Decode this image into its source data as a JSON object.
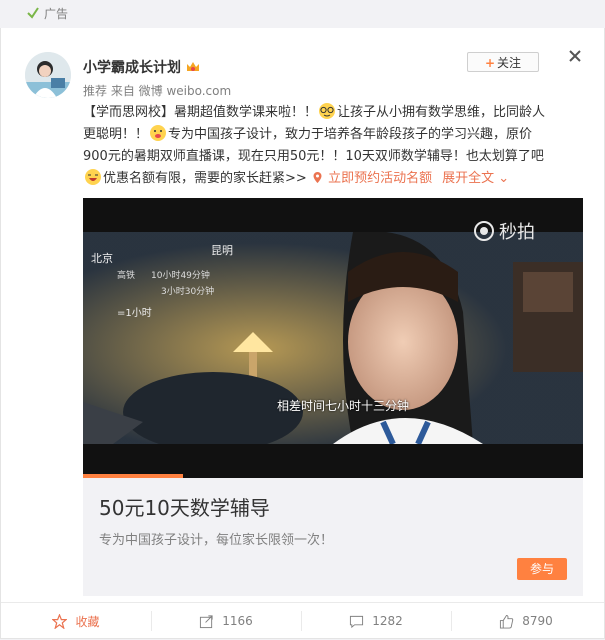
{
  "topbar": {
    "ad_label": "广告",
    "icon": "check-icon"
  },
  "post": {
    "username": "小学霸成长计划",
    "badge_icon": "crown-icon",
    "meta": "推荐 来自 微博 weibo.com",
    "follow_label": "关注",
    "close_icon": "close-icon",
    "lines": [
      {
        "a": "【学而思网校】暑期超值数学课来啦！！",
        "b": "让孩子从小拥有数学思维，比同龄人"
      },
      {
        "a": "更聪明！！",
        "b": "专为中国孩子设计，致力于培养各年龄段孩子的学习兴趣，原价"
      },
      {
        "a": "900元的暑期双师直播课，现在只用50元！！10天双师数学辅导！也太划算了吧"
      },
      {
        "a": "优惠名额有限，需要的家长赶紧>>",
        "link": "立即预约活动名额",
        "more": "展开全文"
      }
    ]
  },
  "video": {
    "brand": "秒拍",
    "subtitle": "相差时间七小时十三分钟",
    "progress": 0.2,
    "chalk": [
      "北京",
      "昆明",
      "高铁",
      "=1小时",
      "10小时49分钟",
      "3小时30分钟"
    ]
  },
  "promo": {
    "title": "50元10天数学辅导",
    "desc": "专为中国孩子设计，每位家长限领一次！",
    "join_label": "参与"
  },
  "actions": [
    {
      "icon": "favorite-icon",
      "label": "收藏"
    },
    {
      "icon": "repost-icon",
      "label": "1166"
    },
    {
      "icon": "comment-icon",
      "label": "1282"
    },
    {
      "icon": "like-icon",
      "label": "8790"
    }
  ],
  "colors": {
    "accent": "#ff8140",
    "link": "#eb7350",
    "text": "#333333",
    "muted": "#808080"
  }
}
